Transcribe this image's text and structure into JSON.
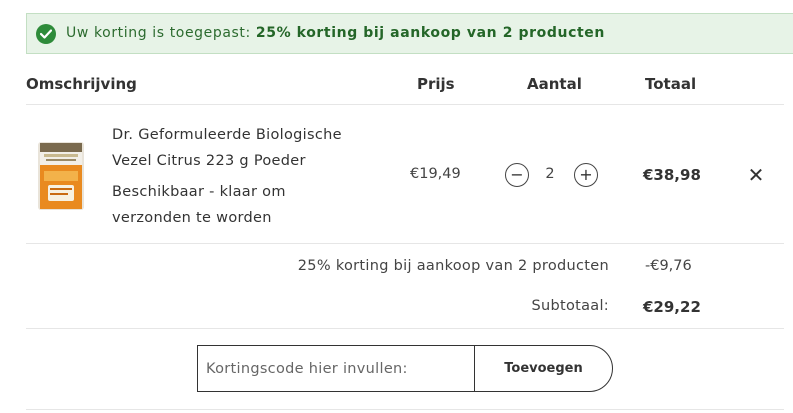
{
  "banner": {
    "prefix": "Uw korting is toegepast: ",
    "discount": "25% korting bij aankoop van 2 producten"
  },
  "table": {
    "headers": {
      "description": "Omschrijving",
      "price": "Prijs",
      "quantity": "Aantal",
      "total": "Totaal"
    }
  },
  "item": {
    "name": "Dr. Geformuleerde Biologische Vezel Citrus 223 g Poeder",
    "availability": "Beschikbaar  -  klaar om verzonden te worden",
    "price": "€19,49",
    "quantity": "2",
    "minus_symbol": "−",
    "plus_symbol": "+",
    "total": "€38,98",
    "remove_symbol": "✕"
  },
  "summary": {
    "discount_label": "25% korting bij aankoop van 2 producten",
    "discount_value": "-€9,76",
    "subtotal_label": "Subtotaal:",
    "subtotal_value": "€29,22"
  },
  "coupon": {
    "placeholder": "Kortingscode hier invullen:",
    "button_label": "Toevoegen"
  },
  "colors": {
    "banner_bg": "#e7f3e7",
    "banner_text": "#2c6b2f",
    "check_icon": "#2e8b3a"
  }
}
